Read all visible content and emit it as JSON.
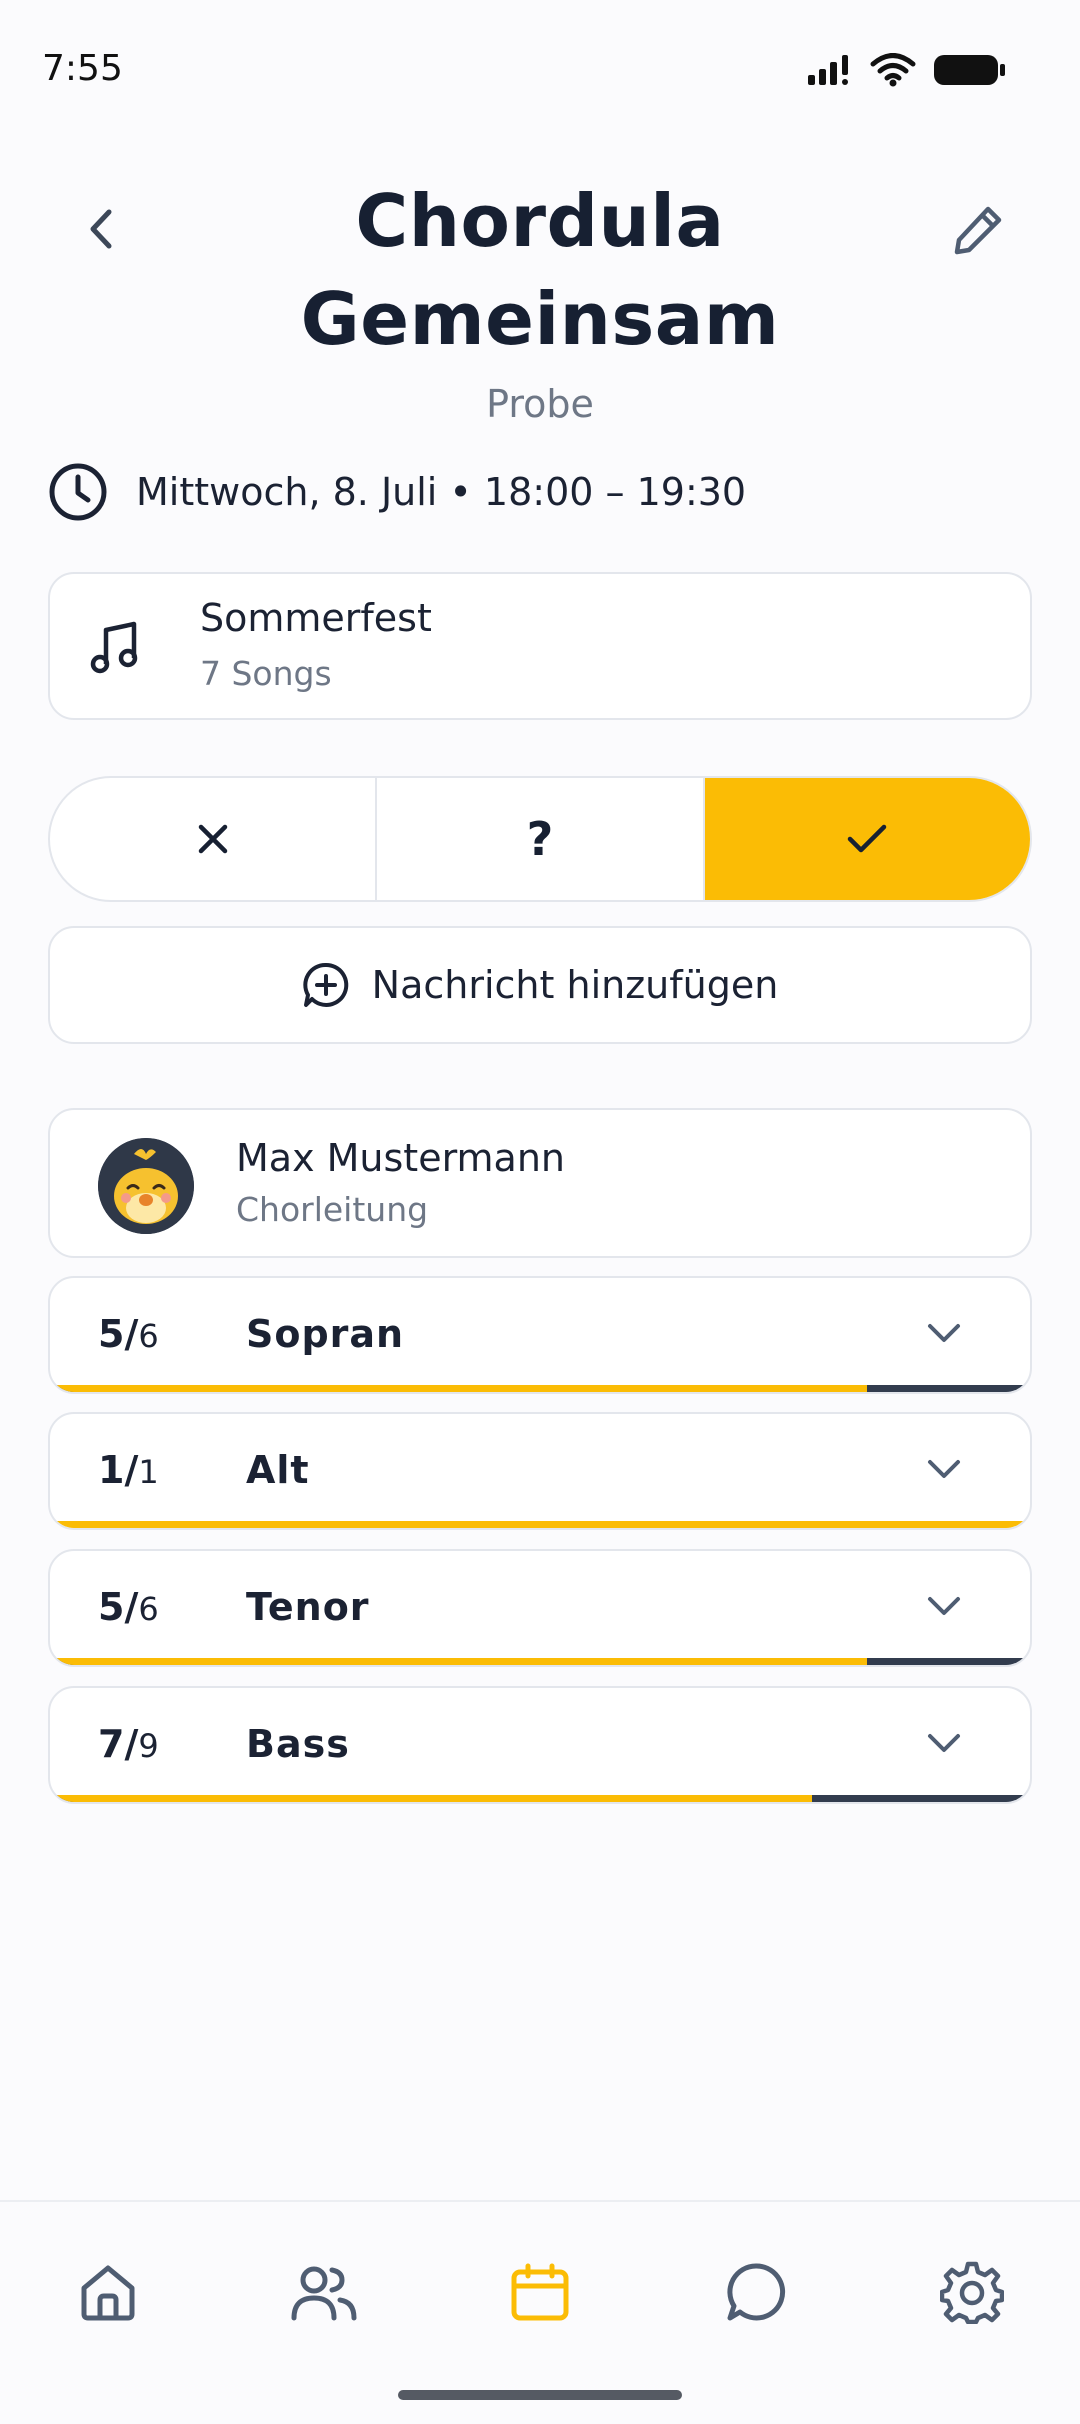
{
  "status_bar": {
    "time": "7:55"
  },
  "header": {
    "title_line1": "Chordula",
    "title_line2": "Gemeinsam",
    "subtitle": "Probe"
  },
  "event": {
    "datetime": "Mittwoch, 8. Juli • 18:00 – 19:30"
  },
  "setlist": {
    "title": "Sommerfest",
    "count": "7 Songs"
  },
  "rsvp": {
    "options": [
      "no",
      "maybe",
      "yes"
    ],
    "maybe_label": "?",
    "selected": "yes",
    "accent_color": "#fbbc05"
  },
  "message_button": {
    "label": "Nachricht hinzufügen"
  },
  "leader": {
    "name": "Max Mustermann",
    "role": "Chorleitung"
  },
  "voices": [
    {
      "name": "Sopran",
      "count": "5/",
      "total": "6",
      "fraction": 0.8333
    },
    {
      "name": "Alt",
      "count": "1/",
      "total": "1",
      "fraction": 1.0
    },
    {
      "name": "Tenor",
      "count": "5/",
      "total": "6",
      "fraction": 0.8333
    },
    {
      "name": "Bass",
      "count": "7/",
      "total": "9",
      "fraction": 0.7778
    }
  ],
  "bottom_nav": {
    "items": [
      "home-icon",
      "members-icon",
      "calendar-icon",
      "chat-icon",
      "settings-icon"
    ],
    "active": "calendar-icon",
    "active_color": "#fbbc05",
    "inactive_color": "#4f5d72"
  }
}
